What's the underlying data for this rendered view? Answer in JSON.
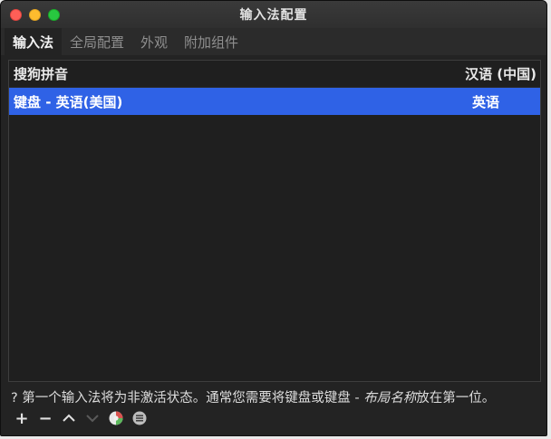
{
  "window": {
    "title": "输入法配置"
  },
  "tabs": [
    {
      "label": "输入法",
      "active": true
    },
    {
      "label": "全局配置",
      "active": false
    },
    {
      "label": "外观",
      "active": false
    },
    {
      "label": "附加组件",
      "active": false
    }
  ],
  "list": {
    "header": {
      "name": "搜狗拼音",
      "language": "汉语 (中国)"
    },
    "rows": [
      {
        "name": "键盘 - 英语(美国)",
        "language": "英语",
        "selected": true
      }
    ]
  },
  "footer": {
    "note_prefix": "? 第一个输入法将为非激活状态。通常您需要将键盘或键盘 - ",
    "note_emphasis": "布局名称",
    "note_suffix": "放在第一位。"
  },
  "toolbar": {
    "add_label": "+",
    "remove_label": "−",
    "buttons": [
      "plus-icon",
      "minus-icon",
      "chevron-up-icon",
      "chevron-down-icon",
      "configure-icon",
      "menu-icon"
    ]
  },
  "colors": {
    "selection": "#2f62e6",
    "window_bg": "#232323"
  }
}
